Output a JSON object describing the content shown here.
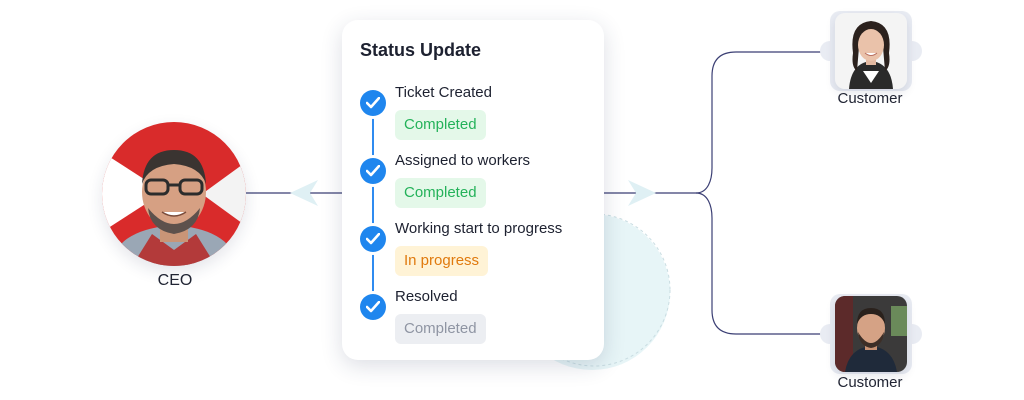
{
  "ceo": {
    "label": "CEO"
  },
  "status_card": {
    "title": "Status Update",
    "steps": [
      {
        "title": "Ticket Created",
        "status": "Completed",
        "tone": "green"
      },
      {
        "title": "Assigned to workers",
        "status": "Completed",
        "tone": "green"
      },
      {
        "title": "Working start to progress",
        "status": "In progress",
        "tone": "orange"
      },
      {
        "title": "Resolved",
        "status": "Completed",
        "tone": "gray"
      }
    ]
  },
  "customers": [
    {
      "label": "Customer"
    },
    {
      "label": "Customer"
    }
  ],
  "colors": {
    "check_blue": "#1f86ee",
    "line_navy": "#3b3f74",
    "badge_green_text": "#24b25a",
    "badge_orange_text": "#e07a0e",
    "badge_gray_text": "#8f95a3",
    "ceo_ring_red": "#e53935"
  }
}
